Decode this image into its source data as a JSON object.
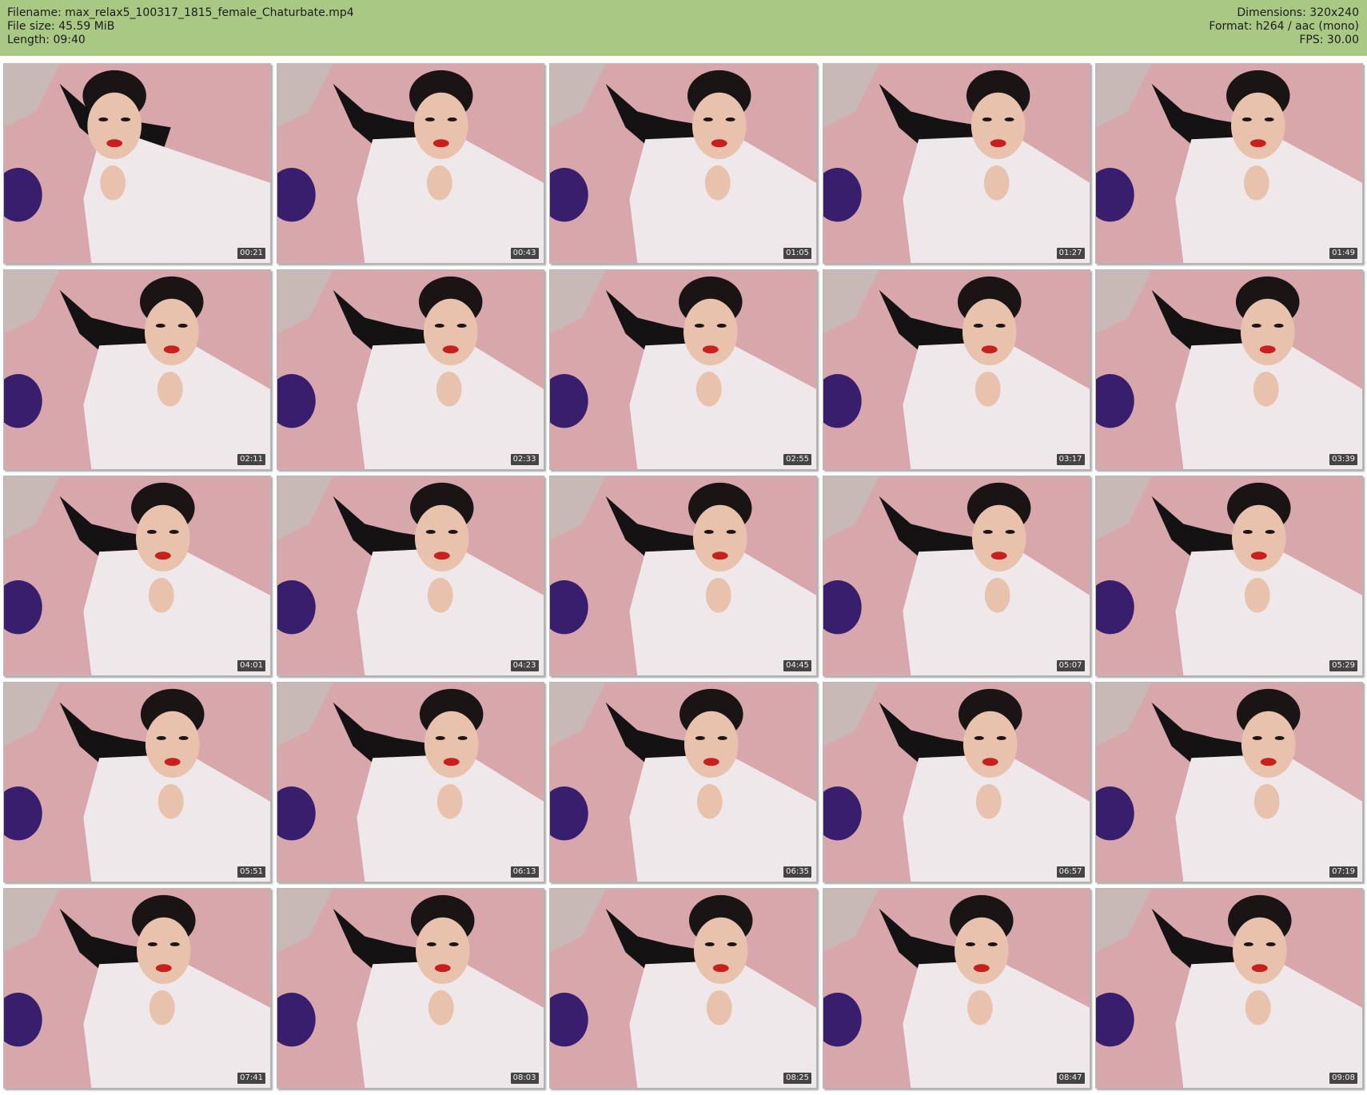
{
  "header": {
    "filename": "Filename: max_relax5_100317_1815_female_Chaturbate.mp4",
    "filesize": "File size: 45.59 MiB",
    "length": "Length: 09:40",
    "dimensions": "Dimensions: 320x240",
    "format": "Format: h264 / aac (mono)",
    "fps": "FPS: 30.00"
  },
  "colors": {
    "header_bg": "#a8c884",
    "bedspread": "#d8a7ac",
    "wall": "#c9b9b6",
    "shirt": "#efe8ea",
    "skirt": "#141212",
    "hair": "#1a1414",
    "skin": "#e8c2ac",
    "lips": "#c8201e",
    "pillow": "#3a1e6e",
    "timestamp_bg": "#1e1e1e"
  },
  "thumbnails": [
    {
      "time": "00:21"
    },
    {
      "time": "00:43"
    },
    {
      "time": "01:05"
    },
    {
      "time": "01:27"
    },
    {
      "time": "01:49"
    },
    {
      "time": "02:11"
    },
    {
      "time": "02:33"
    },
    {
      "time": "02:55"
    },
    {
      "time": "03:17"
    },
    {
      "time": "03:39"
    },
    {
      "time": "04:01"
    },
    {
      "time": "04:23"
    },
    {
      "time": "04:45"
    },
    {
      "time": "05:07"
    },
    {
      "time": "05:29"
    },
    {
      "time": "05:51"
    },
    {
      "time": "06:13"
    },
    {
      "time": "06:35"
    },
    {
      "time": "06:57"
    },
    {
      "time": "07:19"
    },
    {
      "time": "07:41"
    },
    {
      "time": "08:03"
    },
    {
      "time": "08:25"
    },
    {
      "time": "08:47"
    },
    {
      "time": "09:08"
    }
  ]
}
